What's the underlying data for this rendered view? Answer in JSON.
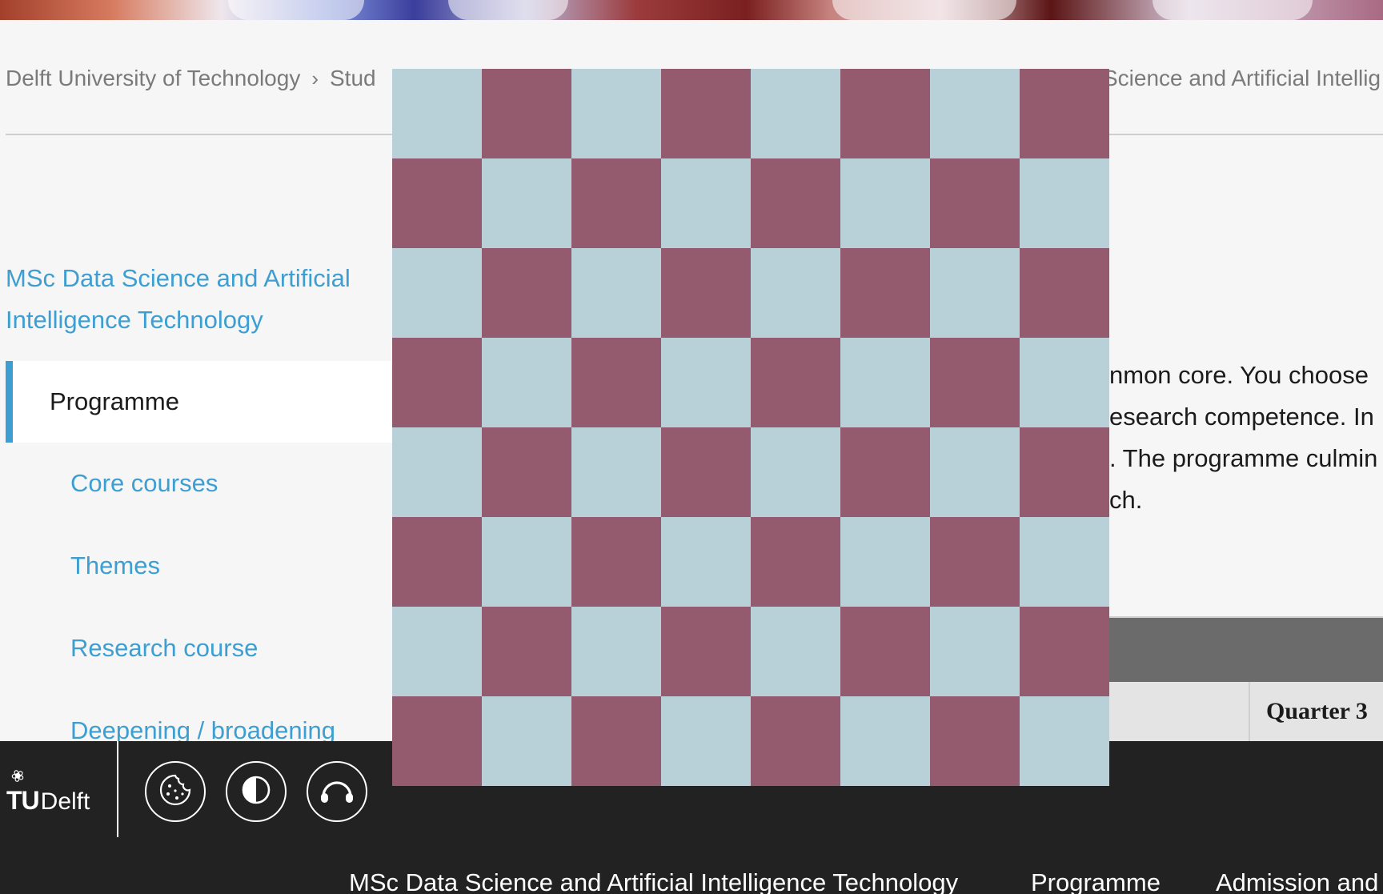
{
  "breadcrumb": {
    "root": "Delft University of Technology",
    "second_partial": "Stud",
    "tail_partial": "Science and Artificial Intellig"
  },
  "sidebar": {
    "title": "MSc Data Science and Artificial Intelligence Technology",
    "active_item": "Programme",
    "items": [
      {
        "label": "Core courses"
      },
      {
        "label": "Themes"
      },
      {
        "label": "Research course"
      },
      {
        "label": "Deepening / broadening"
      }
    ]
  },
  "main": {
    "paragraph_lines": [
      "nmon core. You choose",
      "esearch competence. In",
      ". The programme culmin",
      "ch."
    ],
    "table": {
      "quarter_label": "Quarter 3"
    }
  },
  "footer": {
    "logo_tu": "TU",
    "logo_delft": "Delft",
    "buttons": [
      {
        "icon": "cookie-icon"
      },
      {
        "icon": "contrast-icon"
      },
      {
        "icon": "headphones-icon"
      }
    ],
    "links": [
      "MSc Data Science and Artificial Intelligence Technology",
      "Programme",
      "Admission and"
    ]
  },
  "colors": {
    "accent": "#3d9fd1",
    "footer_bg": "#222222",
    "checker_light": "#b8d0d8",
    "checker_dark": "#935b6d"
  }
}
